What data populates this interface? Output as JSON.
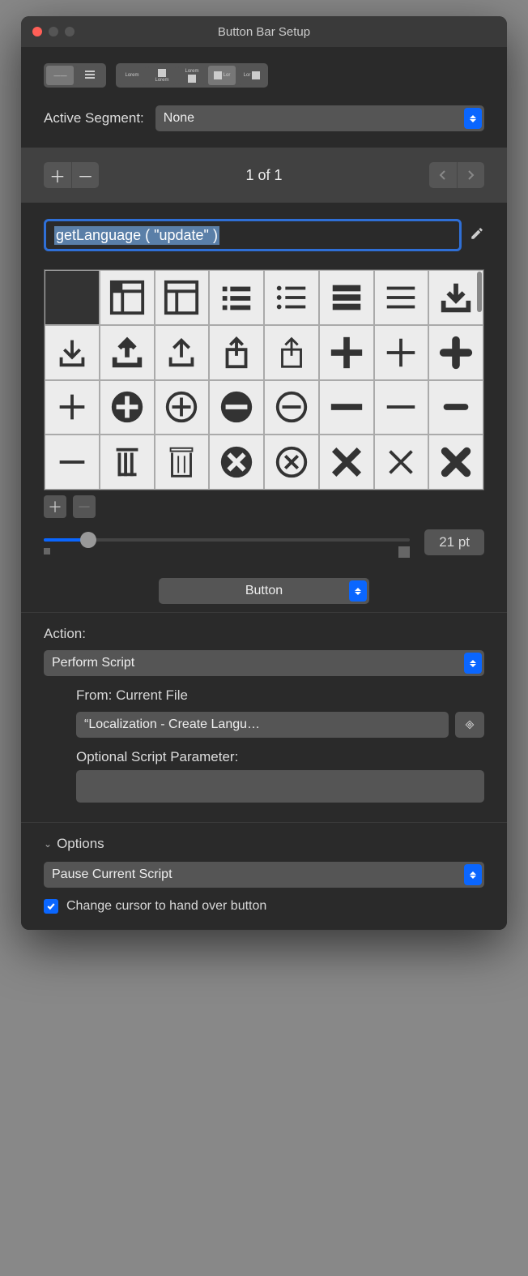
{
  "window": {
    "title": "Button Bar Setup"
  },
  "active_segment": {
    "label": "Active Segment:",
    "value": "None"
  },
  "pager": {
    "counter": "1 of 1"
  },
  "name_field": {
    "value": "getLanguage ( \"update\" )"
  },
  "slider": {
    "size_label": "21 pt"
  },
  "type_select": {
    "value": "Button"
  },
  "action": {
    "label": "Action:",
    "value": "Perform Script",
    "from_label": "From:",
    "from_value": "Current File",
    "script_name": "“Localization - Create Langu…",
    "param_label": "Optional Script Parameter:",
    "param_value": ""
  },
  "options": {
    "header": "Options",
    "pause_value": "Pause Current Script",
    "cursor_label": "Change cursor to hand over button",
    "cursor_checked": true
  }
}
